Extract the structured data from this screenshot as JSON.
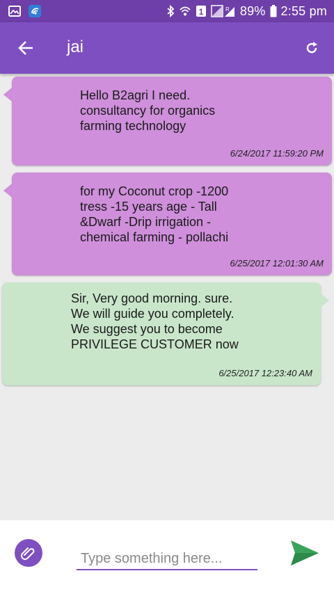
{
  "status_bar": {
    "battery": "89%",
    "time": "2:55 pm",
    "sim_slot": "1",
    "icons": [
      "image-icon",
      "app-notification-icon",
      "bluetooth-icon",
      "wifi-icon",
      "sim-icon",
      "signal-icon",
      "battery-icon"
    ]
  },
  "app_bar": {
    "title": "jai",
    "icons": [
      "back-arrow-icon",
      "refresh-icon"
    ]
  },
  "messages": [
    {
      "direction": "received",
      "text": "Hello B2agri I need.\nconsultancy for organics\nfarming technology",
      "timestamp": "6/24/2017 11:59:20 PM"
    },
    {
      "direction": "received",
      "text": "for my Coconut crop -1200\ntress -15 years age - Tall\n&Dwarf -Drip irrigation -\nchemical farming - pollachi",
      "timestamp": "6/25/2017 12:01:30 AM"
    },
    {
      "direction": "sent",
      "text": "Sir, Very good morning. sure.\nWe will guide you completely.\nWe suggest you to become\nPRIVILEGE CUSTOMER now",
      "timestamp": "6/25/2017 12:23:40 AM"
    }
  ],
  "composer": {
    "placeholder": "Type something here...",
    "value": "",
    "icons": [
      "attach-icon",
      "send-icon"
    ]
  },
  "colors": {
    "status_bar": "#6e3fa8",
    "app_bar": "#7e4fc0",
    "received_bubble": "#cf8fdb",
    "sent_bubble": "#c9e6cb",
    "send_accent": "#3aa35a",
    "background": "#ececec"
  }
}
